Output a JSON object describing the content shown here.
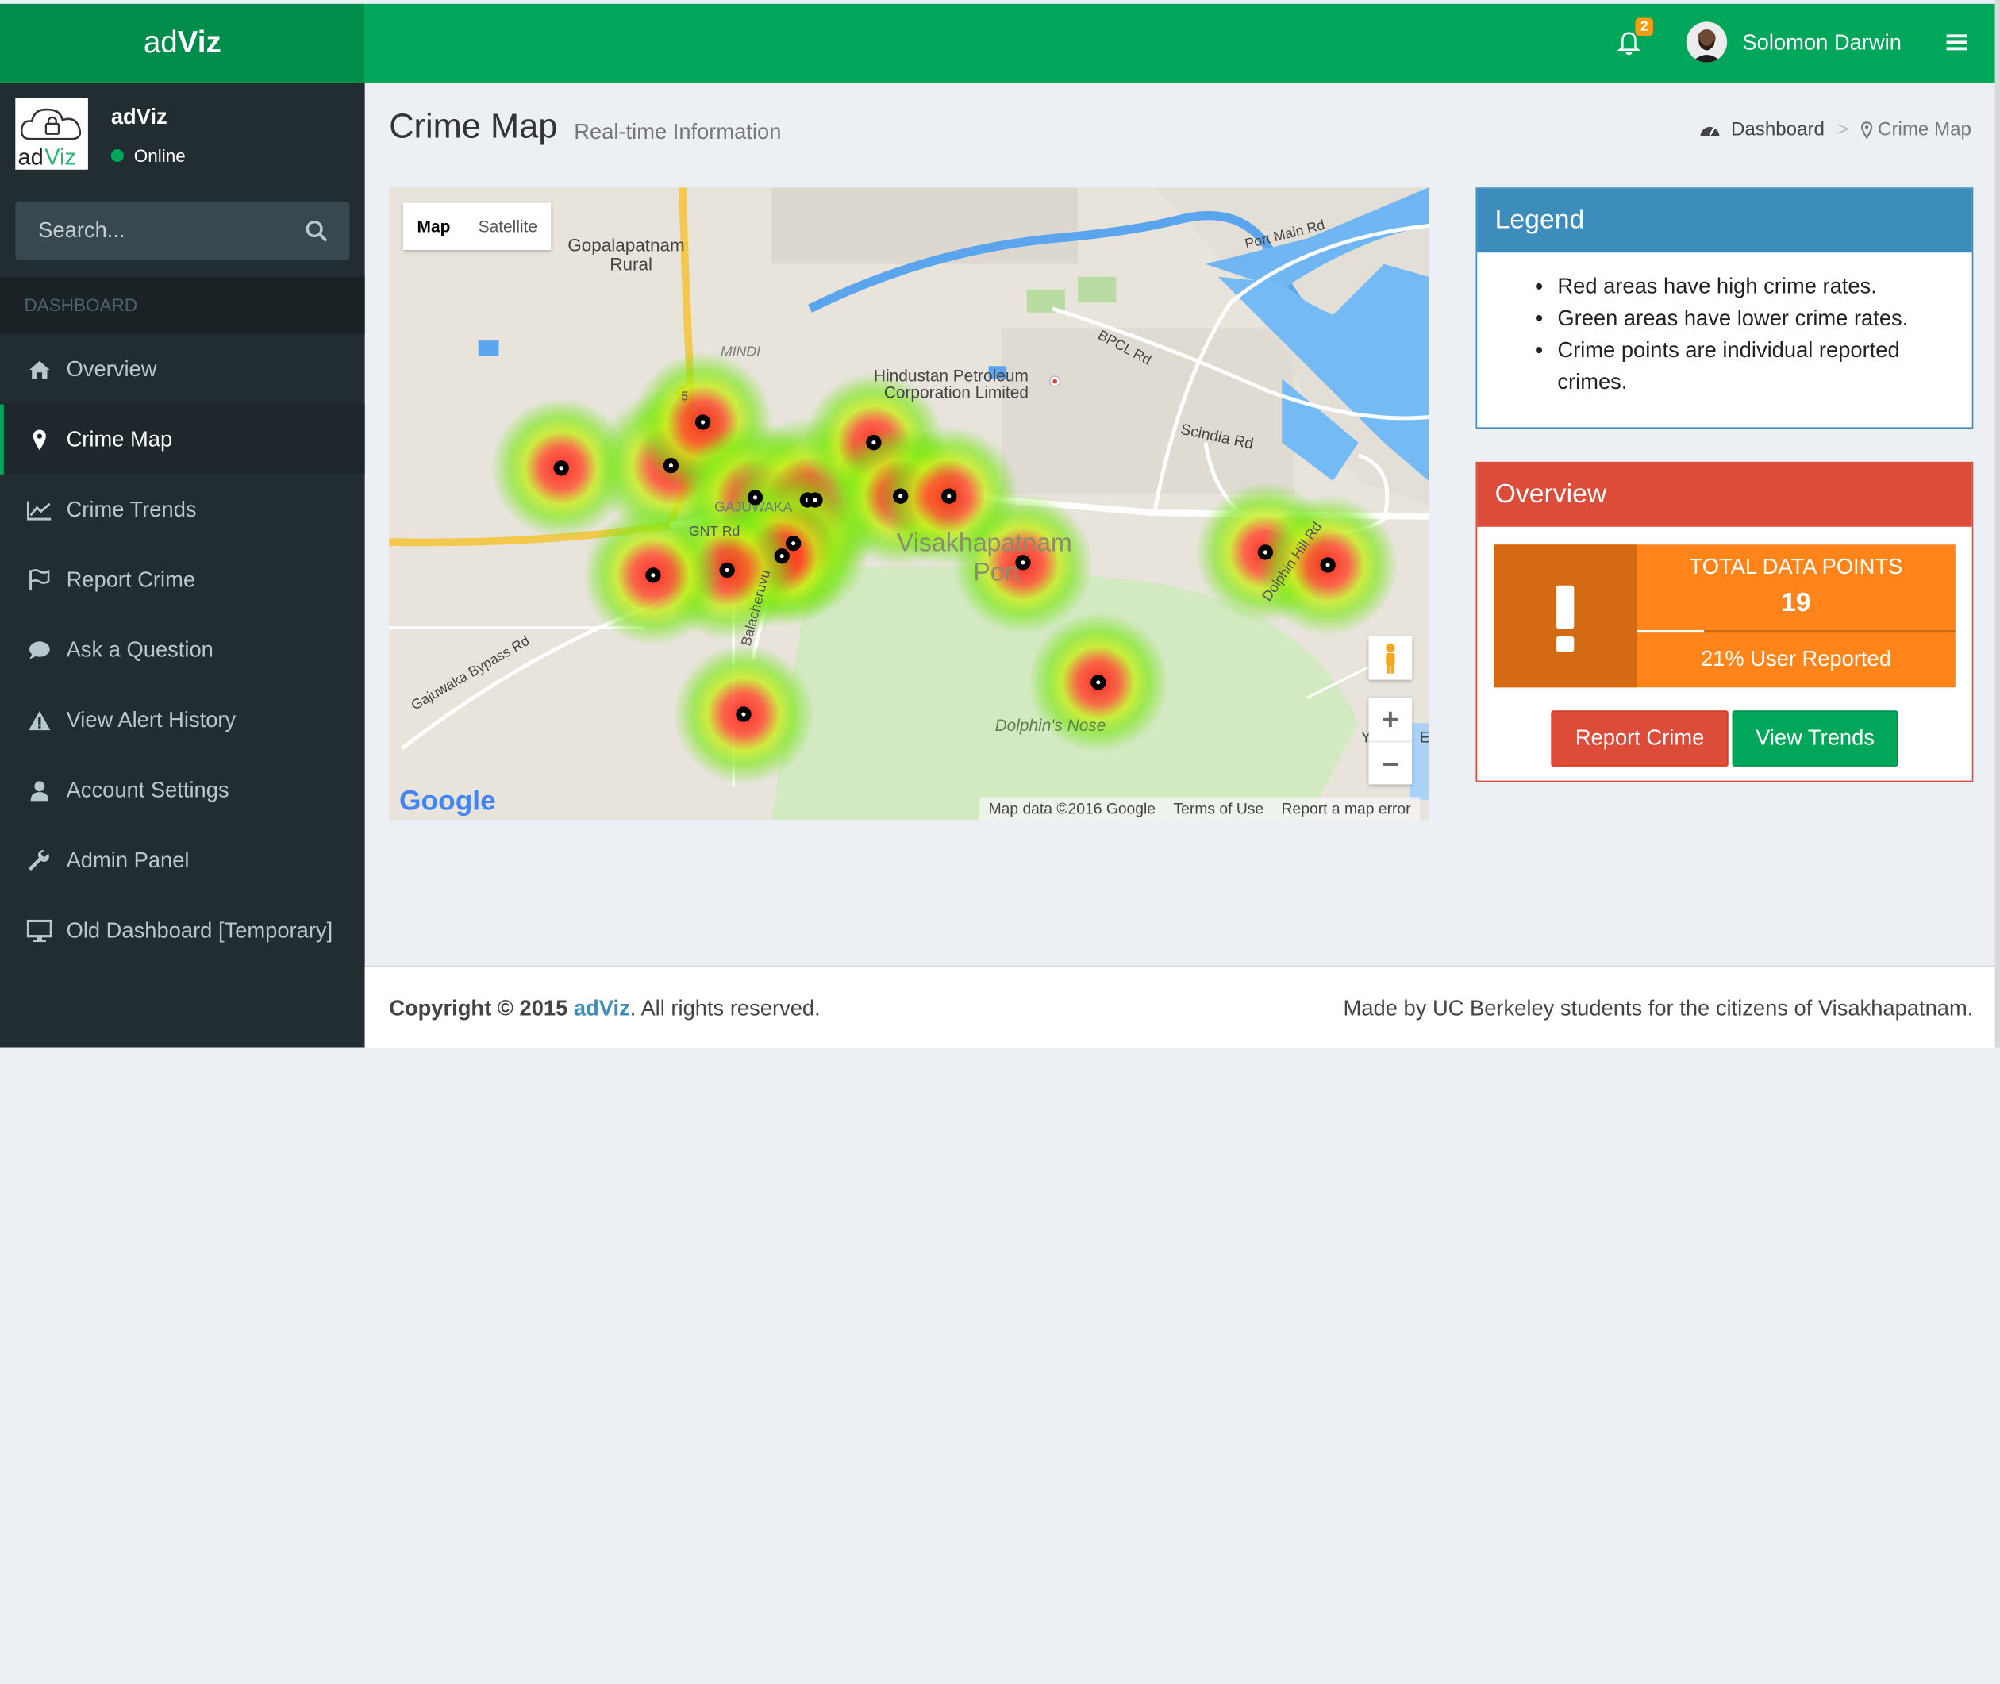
{
  "brand": {
    "logo_prefix": "ad",
    "logo_bold": "Viz"
  },
  "header": {
    "notification_count": "2",
    "user_name": "Solomon Darwin"
  },
  "sidebar": {
    "panel_name": "adViz",
    "panel_status": "Online",
    "search_placeholder": "Search...",
    "section_header": "DASHBOARD",
    "items": [
      {
        "label": "Overview",
        "icon": "home-icon"
      },
      {
        "label": "Crime Map",
        "icon": "map-marker-icon"
      },
      {
        "label": "Crime Trends",
        "icon": "line-chart-icon"
      },
      {
        "label": "Report Crime",
        "icon": "flag-icon"
      },
      {
        "label": "Ask a Question",
        "icon": "comment-icon"
      },
      {
        "label": "View Alert History",
        "icon": "warning-icon"
      },
      {
        "label": "Account Settings",
        "icon": "user-icon"
      },
      {
        "label": "Admin Panel",
        "icon": "wrench-icon"
      },
      {
        "label": "Old Dashboard [Temporary]",
        "icon": "desktop-icon"
      }
    ]
  },
  "page": {
    "title": "Crime Map",
    "subtitle": "Real-time Information"
  },
  "breadcrumb": {
    "home": "Dashboard",
    "current": "Crime Map"
  },
  "map": {
    "type_map": "Map",
    "type_satellite": "Satellite",
    "labels": {
      "gopal": "Gopalapatnam",
      "rural": "Rural",
      "mindi": "MINDI",
      "hindustan1": "Hindustan Petroleum",
      "hindustan2": "Corporation Limited",
      "port_main": "Port Main Rd",
      "bpcl": "BPCL Rd",
      "scindia": "Scindia Rd",
      "gajuwaka": "GAJUWAKA",
      "gnt": "GNT Rd",
      "vizag1": "Visakhapatnam",
      "vizag2": "Port",
      "balacheruvu": "Balacheruvu",
      "bypass": "Gajuwaka Bypass Rd",
      "dolphin_hill": "Dolphin Hill Rd",
      "dolphin_nose": "Dolphin's Nose",
      "route5": "5",
      "edge_y": "Y",
      "edge_e": "E"
    },
    "google": "Google",
    "footer": {
      "data": "Map data ©2016 Google",
      "terms": "Terms of Use",
      "report": "Report a map error"
    }
  },
  "legend": {
    "title": "Legend",
    "items": [
      "Red areas have high crime rates.",
      "Green areas have lower crime rates.",
      "Crime points are individual reported crimes."
    ]
  },
  "overview": {
    "title": "Overview",
    "stat_label": "TOTAL DATA POINTS",
    "stat_value": "19",
    "progress_fraction": 0.21,
    "stat_desc": "21% User Reported",
    "btn_report": "Report Crime",
    "btn_trends": "View Trends"
  },
  "footer": {
    "copyright_prefix": "Copyright © 2015",
    "brand": "adViz",
    "rights": ". All rights reserved.",
    "made_by": "Made by UC Berkeley students for the citizens of Visakhapatnam."
  },
  "colors": {
    "header": "#00a65a",
    "sidebar": "#222d32",
    "legend": "#3c8dbc",
    "overview": "#dd4b39",
    "info": "#ff851b"
  }
}
